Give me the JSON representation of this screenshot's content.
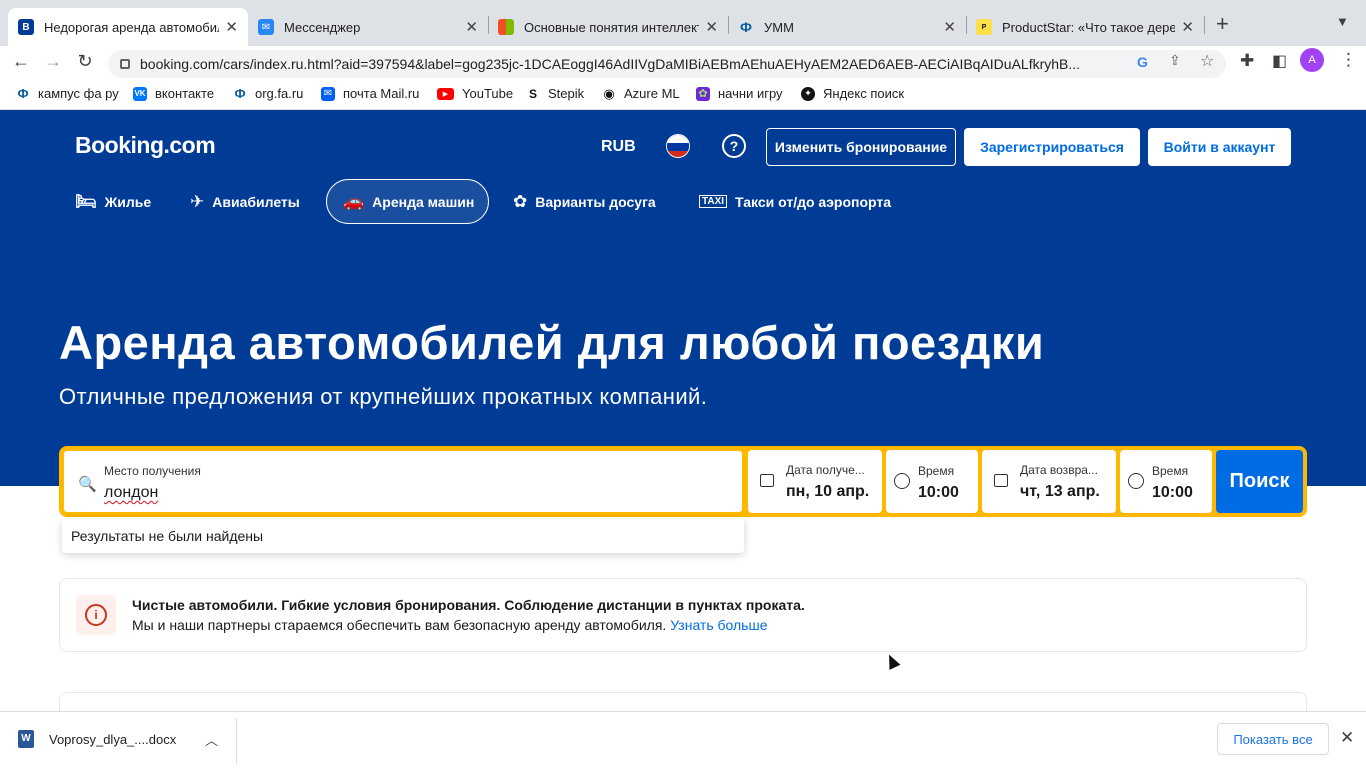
{
  "browser": {
    "tabs": [
      {
        "title": "Недорогая аренда автомобил",
        "favicon": "B",
        "favicon_bg": "#003b95"
      },
      {
        "title": "Мессенджер",
        "favicon": "✉",
        "favicon_bg": "#2787f5"
      },
      {
        "title": "Основные понятия интеллект",
        "favicon": "■",
        "favicon_bg": "#f25022"
      },
      {
        "title": "УММ",
        "favicon": "Ф",
        "favicon_bg": "#ffffff"
      },
      {
        "title": "ProductStar: «Что такое дере",
        "favicon": "P",
        "favicon_bg": "#fde047"
      }
    ],
    "new_tab": "+",
    "url": "booking.com/cars/index.ru.html?aid=397594&label=gog235jc-1DCAEoggI46AdIIVgDaMIBiAEBmAEhuAEHyAEM2AED6AEB-AECiAIBqAIDuALfkryhB...",
    "avatar": "A",
    "bookmarks": [
      {
        "label": "кампус фа ру",
        "icon": "Ф"
      },
      {
        "label": "вконтакте",
        "icon": "VK"
      },
      {
        "label": "org.fa.ru",
        "icon": "Ф"
      },
      {
        "label": "почта Mail.ru",
        "icon": "✉"
      },
      {
        "label": "YouTube",
        "icon": "▶"
      },
      {
        "label": "Stepik",
        "icon": "S"
      },
      {
        "label": "Azure ML",
        "icon": "◉"
      },
      {
        "label": "начни игру",
        "icon": "✿"
      },
      {
        "label": "Яндекс поиск",
        "icon": "✦"
      }
    ]
  },
  "header": {
    "logo": "Booking.com",
    "currency": "RUB",
    "help": "?",
    "change_booking": "Изменить бронирование",
    "register": "Зарегистрироваться",
    "login": "Войти в аккаунт"
  },
  "nav": [
    {
      "label": "Жилье",
      "icon": "bed-icon"
    },
    {
      "label": "Авиабилеты",
      "icon": "plane-icon"
    },
    {
      "label": "Аренда машин",
      "icon": "car-icon"
    },
    {
      "label": "Варианты досуга",
      "icon": "attractions-icon"
    },
    {
      "label": "Такси от/до аэропорта",
      "icon": "taxi-icon"
    }
  ],
  "hero": {
    "title": "Аренда автомобилей для любой поездки",
    "subtitle": "Отличные предложения от крупнейших прокатных компаний."
  },
  "search": {
    "place_label": "Место получения",
    "place_value": "лондон",
    "pickup_date_label": "Дата получе...",
    "pickup_date": "пн, 10 апр.",
    "pickup_time_label": "Время",
    "pickup_time": "10:00",
    "return_date_label": "Дата возвра...",
    "return_date": "чт, 13 апр.",
    "return_time_label": "Время",
    "return_time": "10:00",
    "button": "Поиск",
    "no_results": "Результаты не были найдены"
  },
  "notice": {
    "title": "Чистые автомобили. Гибкие условия бронирования. Соблюдение дистанции в пунктах проката.",
    "text": "Мы и наши партнеры стараемся обеспечить вам безопасную аренду автомобиля.",
    "link": "Узнать больше"
  },
  "downloads": {
    "file": "Voprosy_dlya_....docx",
    "file_icon": "W",
    "show_all": "Показать все"
  },
  "colors": {
    "brand": "#003b95",
    "accent": "#006ce4",
    "search_border": "#ffb700"
  }
}
